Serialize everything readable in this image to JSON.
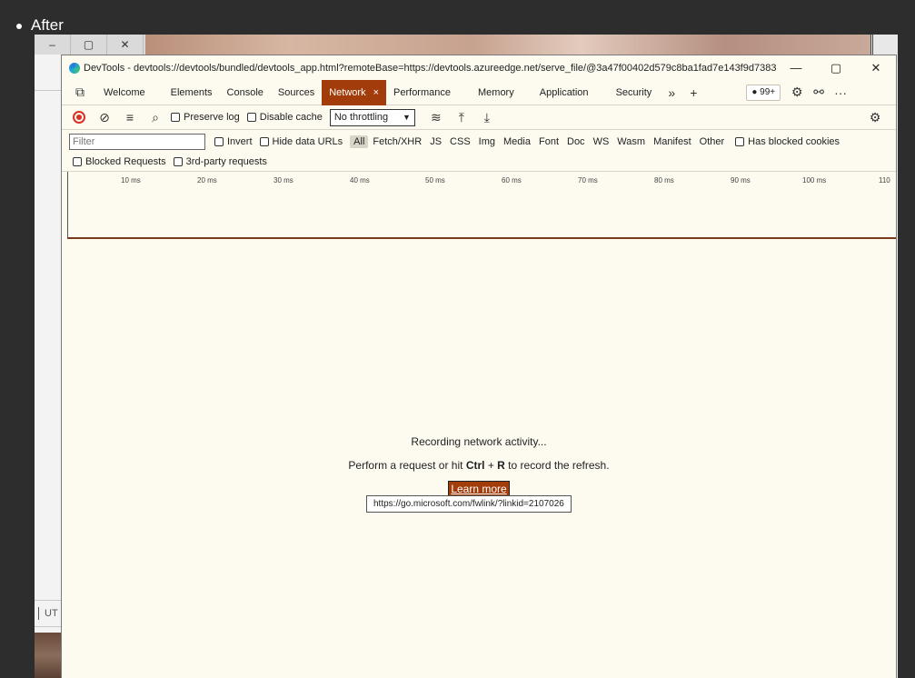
{
  "bullet": "After",
  "bg_window": {
    "restore_glyph": "▢",
    "close_glyph": "✕",
    "minimize_glyph": "–",
    "ut_label": "UT"
  },
  "devtools": {
    "title": "DevTools - devtools://devtools/bundled/devtools_app.html?remoteBase=https://devtools.azureedge.net/serve_file/@3a47f00402d579c8ba1fad7e143f9d7383...",
    "window_controls": {
      "minimize": "—",
      "maximize": "▢",
      "close": "✕"
    },
    "tabs": [
      "Welcome",
      "Elements",
      "Console",
      "Sources",
      "Network",
      "Performance",
      "Memory",
      "Application",
      "Security"
    ],
    "active_tab": "Network",
    "active_tab_close": "×",
    "more_tabs": "»",
    "add_tab": "+",
    "issues_badge": "99+",
    "more_menu": "···",
    "toolbar": {
      "preserve_log": "Preserve log",
      "disable_cache": "Disable cache",
      "throttling": "No throttling"
    },
    "filter": {
      "placeholder": "Filter",
      "invert": "Invert",
      "hide_data_urls": "Hide data URLs",
      "types": [
        "All",
        "Fetch/XHR",
        "JS",
        "CSS",
        "Img",
        "Media",
        "Font",
        "Doc",
        "WS",
        "Wasm",
        "Manifest",
        "Other"
      ],
      "selected_type": "All",
      "has_blocked_cookies": "Has blocked cookies",
      "blocked_requests": "Blocked Requests",
      "third_party": "3rd-party requests"
    },
    "timeline_ticks": [
      "10 ms",
      "20 ms",
      "30 ms",
      "40 ms",
      "50 ms",
      "60 ms",
      "70 ms",
      "80 ms",
      "90 ms",
      "100 ms",
      "110"
    ],
    "empty_state": {
      "recording": "Recording network activity...",
      "hint_prefix": "Perform a request or hit ",
      "hint_key1": "Ctrl",
      "hint_plus": " + ",
      "hint_key2": "R",
      "hint_suffix": " to record the refresh.",
      "learn_more": "Learn more",
      "tooltip_url": "https://go.microsoft.com/fwlink/?linkid=2107026"
    }
  },
  "colors": {
    "accent": "#a23c0a",
    "panel_bg": "#fdfaf0",
    "outer_bg": "#2d2d2d"
  }
}
